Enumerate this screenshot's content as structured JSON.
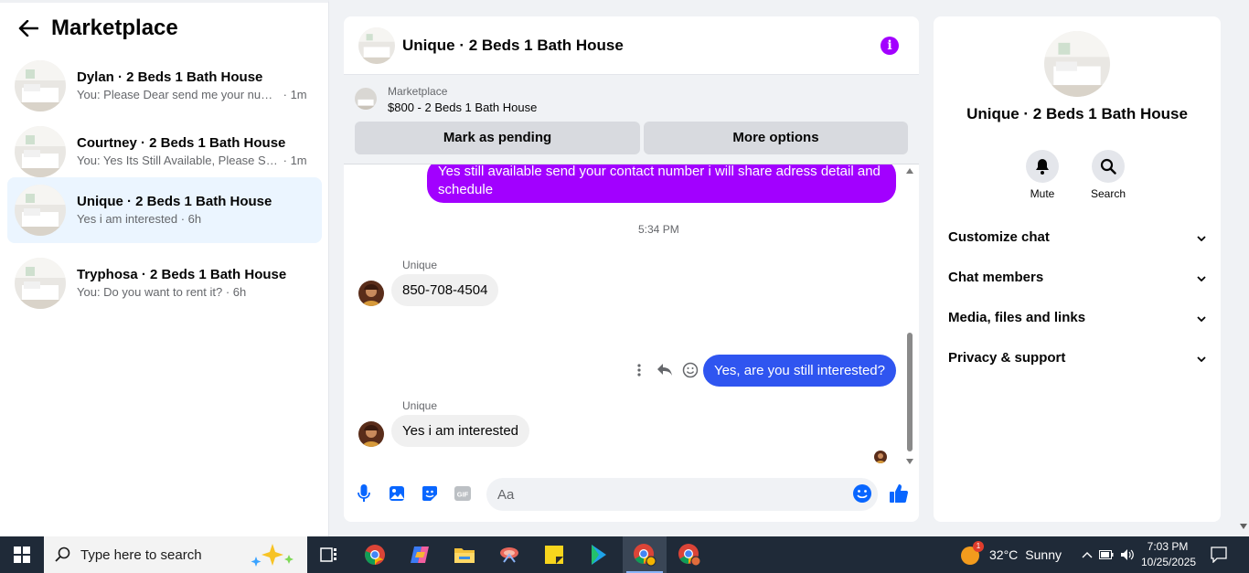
{
  "sidebar": {
    "title": "Marketplace",
    "conversations": [
      {
        "name": "Dylan · 2 Beds 1 Bath House",
        "preview": "You: Please Dear send me your numb...",
        "time": "· 1m",
        "active": false
      },
      {
        "name": "Courtney · 2 Beds 1 Bath House",
        "preview": "You: Yes Its Still Available, Please Sen...",
        "time": "· 1m",
        "active": false
      },
      {
        "name": "Unique · 2 Beds 1 Bath House",
        "preview": "Yes i am interested",
        "time": "· 6h",
        "active": true
      },
      {
        "name": "Tryphosa · 2 Beds 1 Bath House",
        "preview": "You: Do you want to rent it?",
        "time": "· 6h",
        "active": false
      }
    ]
  },
  "chat": {
    "title": "Unique · 2 Beds 1 Bath House",
    "marketplace_label": "Marketplace",
    "listing": "$800 - 2 Beds 1 Bath House",
    "mark_pending": "Mark as pending",
    "more_options": "More options",
    "msg_out_1": "Yes still available send your contact number i will share adress detail and schedule",
    "timestamp": "5:34 PM",
    "sender_1": "Unique",
    "msg_in_1": "850-708-4504",
    "msg_out_2": "Yes, are you still interested?",
    "sender_2": "Unique",
    "msg_in_2": "Yes i am interested",
    "input_placeholder": "Aa"
  },
  "info_panel": {
    "title": "Unique · 2 Beds 1 Bath House",
    "mute_label": "Mute",
    "search_label": "Search",
    "sections": [
      "Customize chat",
      "Chat members",
      "Media, files and links",
      "Privacy & support"
    ]
  },
  "taskbar": {
    "search_placeholder": "Type here to search",
    "weather_badge": "1",
    "temperature": "32°C",
    "weather": "Sunny",
    "time": "7:03 PM",
    "date": "10/25/2025"
  },
  "colors": {
    "accent_purple": "#a200ff",
    "outgoing_blue": "#2f55f0",
    "active_conv_bg": "#ebf5ff",
    "messenger_blue": "#0866ff"
  }
}
